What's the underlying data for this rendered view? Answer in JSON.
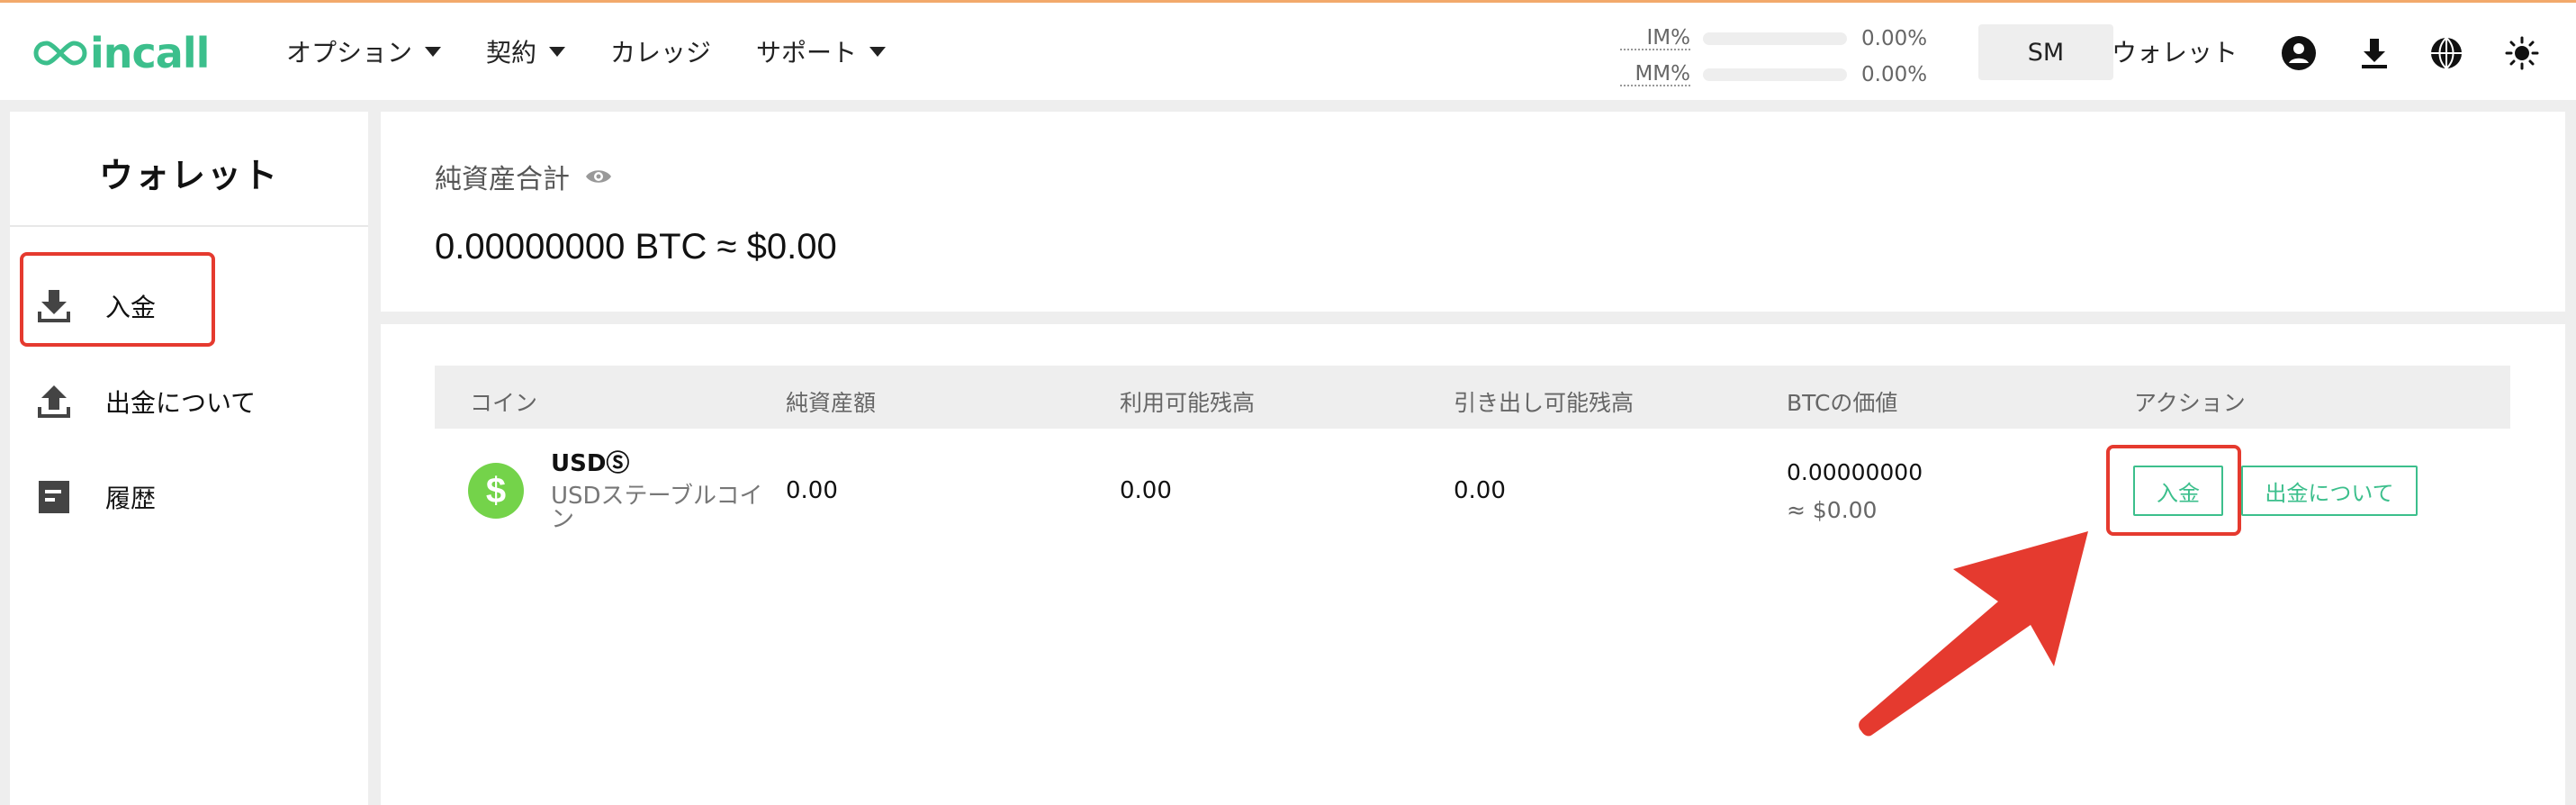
{
  "header": {
    "logo_text": "incall",
    "nav": [
      {
        "label": "オプション",
        "has_caret": true
      },
      {
        "label": "契約",
        "has_caret": true
      },
      {
        "label": "カレッジ",
        "has_caret": false
      },
      {
        "label": "サポート",
        "has_caret": true
      }
    ],
    "im_label": "IM%",
    "im_value": "0.00%",
    "mm_label": "MM%",
    "mm_value": "0.00%",
    "account_button": "SM",
    "wallet_link": "ウォレット",
    "icons": [
      "account-circle-icon",
      "download-icon",
      "globe-icon",
      "sun-icon"
    ]
  },
  "sidebar": {
    "title": "ウォレット",
    "items": [
      {
        "label": "入金",
        "icon": "deposit-icon"
      },
      {
        "label": "出金について",
        "icon": "withdraw-icon"
      },
      {
        "label": "履歴",
        "icon": "history-icon"
      }
    ]
  },
  "summary": {
    "label": "純資産合計",
    "total": "0.00000000 BTC ≈ $0.00"
  },
  "table": {
    "columns": [
      "コイン",
      "純資産額",
      "利用可能残高",
      "引き出し可能残高",
      "BTCの価値",
      "アクション"
    ],
    "rows": [
      {
        "coin_symbol": "$",
        "coin_name": "USDⓈ",
        "coin_desc": "USDステーブルコイン",
        "net_assets": "0.00",
        "available": "0.00",
        "withdrawable": "0.00",
        "btc_value": "0.00000000",
        "usd_value": "≈ $0.00",
        "deposit_label": "入金",
        "withdraw_label": "出金について"
      }
    ]
  },
  "colors": {
    "brand": "#3cbf8c",
    "highlight": "#e53a2f",
    "coin": "#74d34a"
  }
}
